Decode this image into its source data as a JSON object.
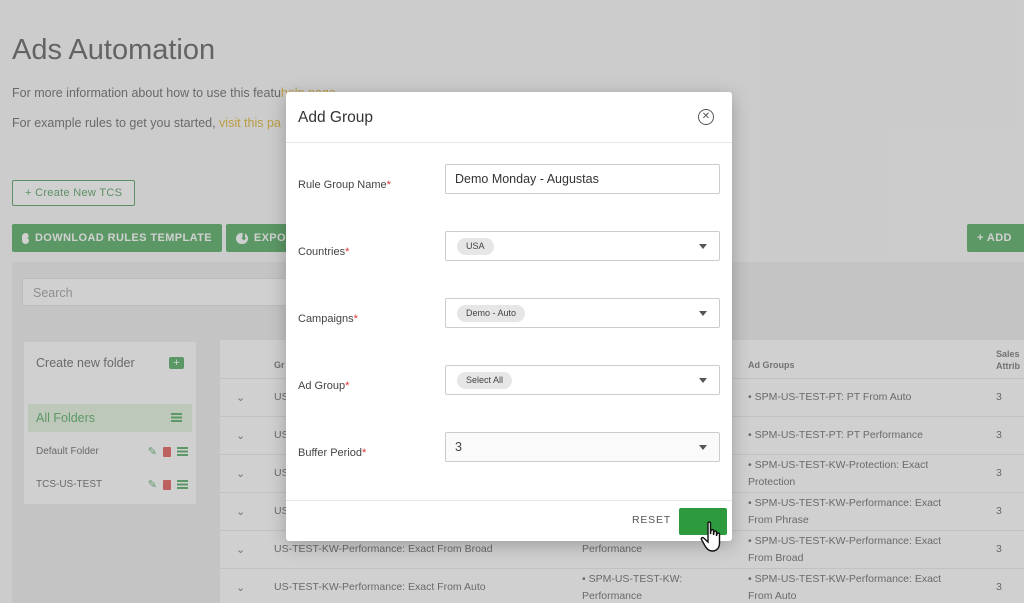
{
  "page": {
    "title": "Ads Automation",
    "info_line1_prefix": "For more information about how to use this featu",
    "info_line1_link": "help page",
    "info_line2_prefix": "For example rules to get you started, ",
    "info_line2_link": "visit this pa",
    "create_tcs": "+ Create New TCS",
    "download_template": "DOWNLOAD RULES TEMPLATE",
    "export": "EXPO",
    "add": "+ ADD",
    "search_placeholder": "Search"
  },
  "folders": {
    "create_label": "Create new folder",
    "items": [
      {
        "label": "All Folders"
      },
      {
        "label": "Default Folder"
      },
      {
        "label": "TCS-US-TEST"
      }
    ]
  },
  "table": {
    "headers": {
      "group": "Gr",
      "ad_groups": "Ad Groups",
      "sales": "Sales Attrib"
    },
    "rows": [
      {
        "name": "US",
        "campaign": "",
        "ad_groups": "• SPM-US-TEST-PT: PT From Auto",
        "sales": "3"
      },
      {
        "name": "US",
        "campaign": "",
        "ad_groups": "• SPM-US-TEST-PT: PT Performance",
        "sales": "3"
      },
      {
        "name": "US",
        "campaign": "",
        "ad_groups": "• SPM-US-TEST-KW-Protection: Exact Protection",
        "sales": "3"
      },
      {
        "name": "US",
        "campaign": "",
        "ad_groups": "• SPM-US-TEST-KW-Performance: Exact From Phrase",
        "sales": "3"
      },
      {
        "name": "US-TEST-KW-Performance: Exact From Broad",
        "campaign": "Performance",
        "ad_groups": "• SPM-US-TEST-KW-Performance: Exact From Broad",
        "sales": "3"
      },
      {
        "name": "US-TEST-KW-Performance: Exact From Auto",
        "campaign": "• SPM-US-TEST-KW: Performance",
        "ad_groups": "• SPM-US-TEST-KW-Performance: Exact From Auto",
        "sales": "3"
      }
    ]
  },
  "modal": {
    "title": "Add Group",
    "fields": {
      "rule_group_name": {
        "label": "Rule Group Name",
        "value": "Demo Monday - Augustas"
      },
      "countries": {
        "label": "Countries",
        "chip": "USA"
      },
      "campaigns": {
        "label": "Campaigns",
        "chip": "Demo - Auto"
      },
      "ad_group": {
        "label": "Ad Group",
        "chip": "Select All"
      },
      "buffer_period": {
        "label": "Buffer Period",
        "value": "3"
      }
    },
    "required_mark": "*",
    "reset_label": "RESET"
  },
  "colors": {
    "accent": "#2d9a3e",
    "required": "#d33333",
    "link": "#d9a300"
  }
}
